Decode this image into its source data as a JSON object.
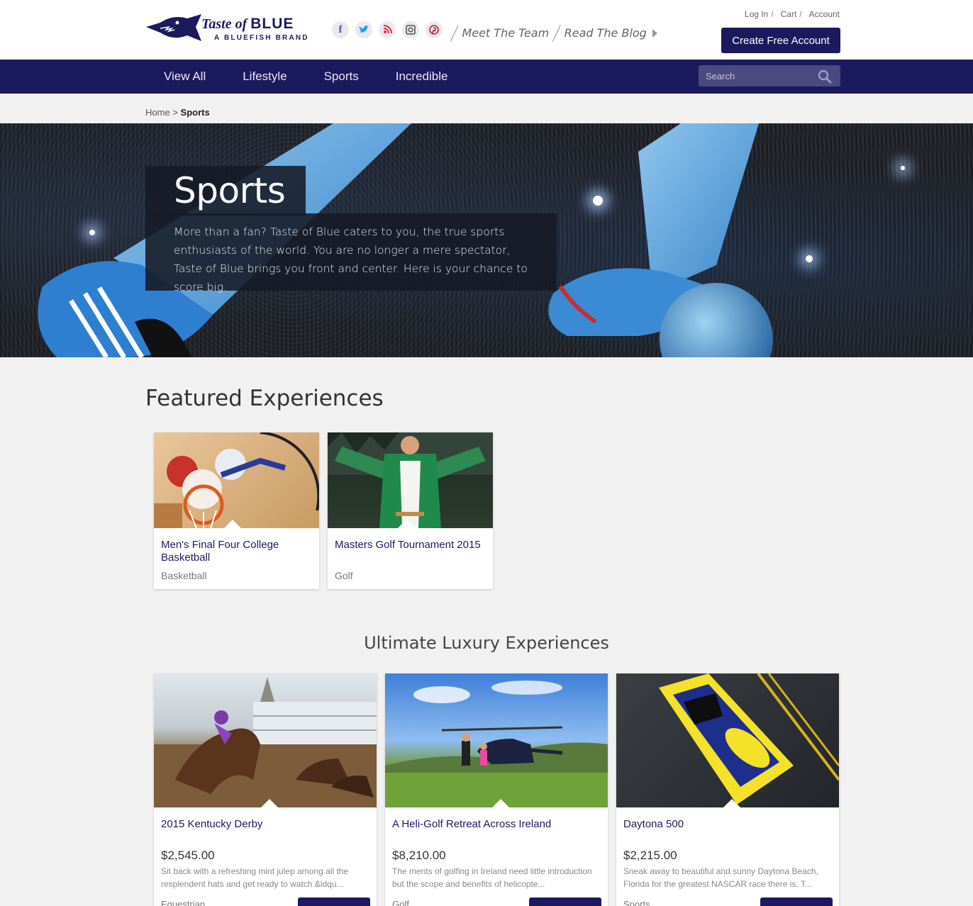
{
  "brand": {
    "name_italic": "Taste of",
    "name_bold": "BLUE",
    "tagline": "A BLUEFISH BRAND"
  },
  "social_icons": [
    "facebook-icon",
    "twitter-icon",
    "blog-icon",
    "instagram-icon",
    "pinterest-icon"
  ],
  "header_links": {
    "meet_team": "Meet The Team",
    "read_blog": "Read The Blog"
  },
  "account_links": {
    "login": "Log In",
    "cart": "Cart",
    "account": "Account",
    "create_account": "Create Free Account"
  },
  "nav": {
    "items": [
      "View All",
      "Lifestyle",
      "Sports",
      "Incredible"
    ]
  },
  "search": {
    "placeholder": "Search"
  },
  "breadcrumb": {
    "home": "Home",
    "separator": ">",
    "current": "Sports"
  },
  "hero": {
    "title": "Sports",
    "description": "More than a fan? Taste of Blue caters to you, the true sports enthusiasts of the world. You are no longer a mere spectator, Taste of Blue brings you front and center. Here is your chance to score big."
  },
  "featured": {
    "heading": "Featured Experiences",
    "cards": [
      {
        "title": "Men's Final Four College Basketball",
        "category": "Basketball"
      },
      {
        "title": "Masters Golf Tournament 2015",
        "category": "Golf"
      }
    ]
  },
  "luxury": {
    "heading": "Ultimate Luxury Experiences",
    "cards": [
      {
        "title": "2015 Kentucky Derby",
        "price": "$2,545.00",
        "description": "Sit back with a refreshing mint julep among all the resplendent hats and get ready to watch &ldqu...",
        "category": "Equestrian"
      },
      {
        "title": "A Heli-Golf Retreat Across Ireland",
        "price": "$8,210.00",
        "description": "The merits of golfing in Ireland need little introduction but the scope and benefits of helicopte...",
        "category": "Golf"
      },
      {
        "title": "Daytona 500",
        "price": "$2,215.00",
        "description": "Sneak away to beautiful and sunny Daytona Beach, Florida for the greatest NASCAR race there is. T...",
        "category": "Sports"
      }
    ]
  },
  "colors": {
    "brand_navy": "#1b1a5e",
    "page_bg": "#f1f1f1"
  }
}
